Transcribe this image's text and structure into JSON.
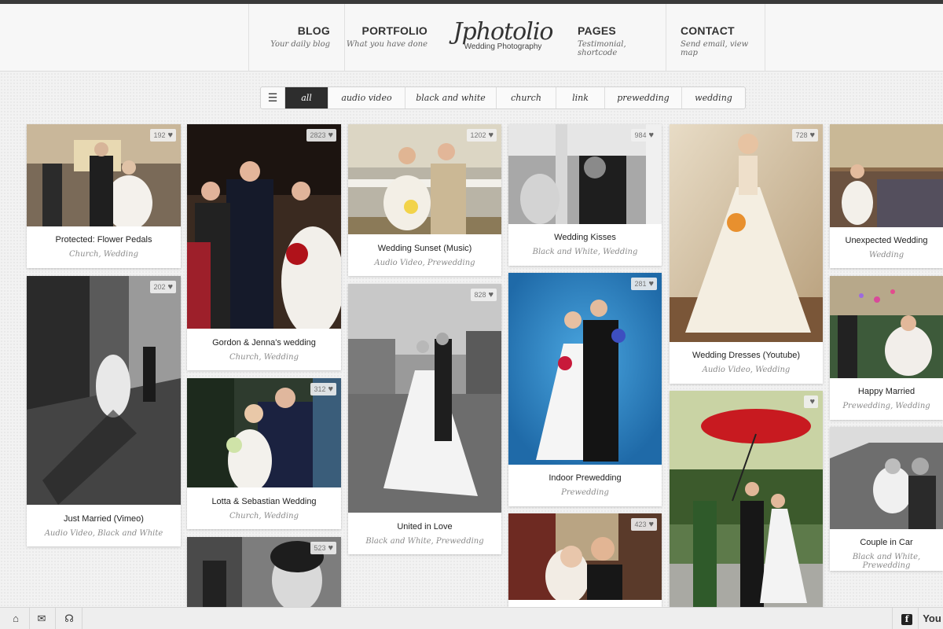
{
  "nav": {
    "blog": {
      "title": "BLOG",
      "subtitle": "Your daily blog"
    },
    "portfolio": {
      "title": "PORTFOLIO",
      "subtitle": "What you have done"
    },
    "pages": {
      "title": "PAGES",
      "subtitle": "Testimonial, shortcode"
    },
    "contact": {
      "title": "CONTACT",
      "subtitle": "Send email, view map"
    }
  },
  "logo": {
    "name": "Jphotolio",
    "tagline": "Wedding Photography"
  },
  "filters": {
    "menu_icon": "menu-icon",
    "items": [
      "all",
      "audio video",
      "black and white",
      "church",
      "link",
      "prewedding",
      "wedding"
    ],
    "active": "all"
  },
  "cards": {
    "flower_pedals": {
      "likes": "192",
      "title": "Protected: Flower Pedals",
      "cats": "Church, Wedding"
    },
    "just_married": {
      "likes": "202",
      "title": "Just Married (Vimeo)",
      "cats": "Audio Video, Black and White"
    },
    "gordon_jenna": {
      "likes": "2823",
      "title": "Gordon & Jenna's wedding",
      "cats": "Church, Wedding"
    },
    "lotta_sebastian": {
      "likes": "312",
      "title": "Lotta & Sebastian Wedding",
      "cats": "Church, Wedding"
    },
    "bw_woman": {
      "likes": "523"
    },
    "wedding_sunset": {
      "likes": "1202",
      "title": "Wedding Sunset (Music)",
      "cats": "Audio Video, Prewedding"
    },
    "united_in_love": {
      "likes": "828",
      "title": "United in Love",
      "cats": "Black and White, Prewedding"
    },
    "wedding_kisses": {
      "likes": "984",
      "title": "Wedding Kisses",
      "cats": "Black and White, Wedding"
    },
    "indoor_prewedding": {
      "likes": "281",
      "title": "Indoor Prewedding",
      "cats": "Prewedding"
    },
    "couple_smile": {
      "likes": "423"
    },
    "wedding_dresses": {
      "likes": "728",
      "title": "Wedding Dresses (Youtube)",
      "cats": "Audio Video, Wedding"
    },
    "red_umbrella": {
      "likes": ""
    },
    "unexpected_wedding": {
      "title": "Unexpected Wedding",
      "cats": "Wedding"
    },
    "happy_married": {
      "title": "Happy Married",
      "cats": "Prewedding, Wedding"
    },
    "couple_in_car": {
      "title": "Couple in Car",
      "cats": "Black and White, Prewedding"
    }
  },
  "colors": {
    "header_top": "#3a3a3a",
    "active_filter": "#2d2d2d"
  },
  "footer_icons": [
    "home-icon",
    "mail-icon",
    "headphones-icon",
    "facebook-icon",
    "youtube-icon"
  ],
  "footer": {
    "facebook": "f",
    "youtube": "You"
  }
}
